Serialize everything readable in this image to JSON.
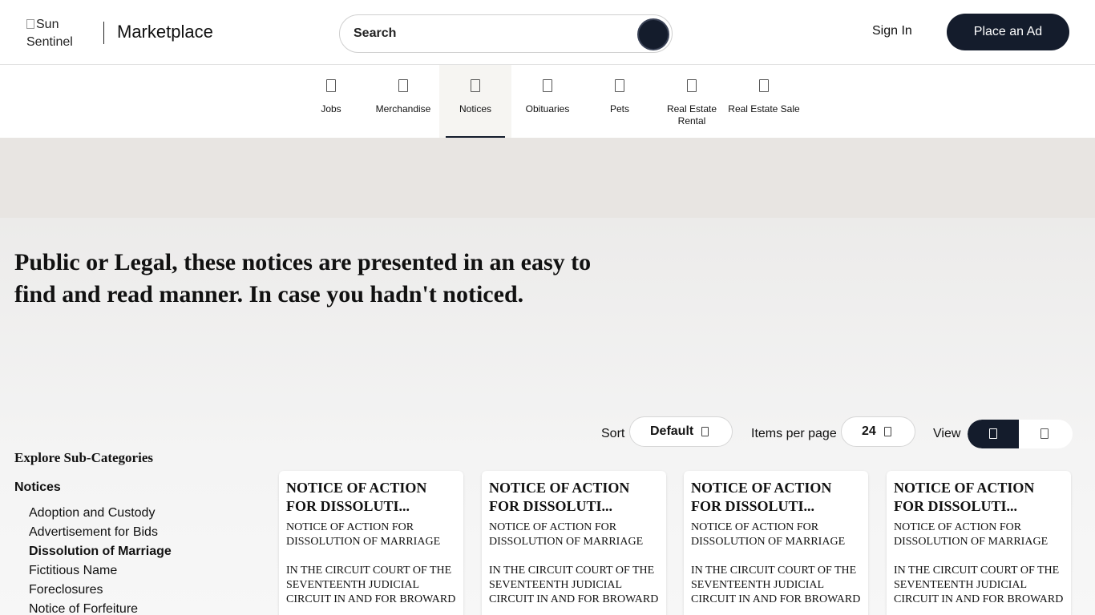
{
  "header": {
    "logo_alt": "Sun Sentinel",
    "brand": "Marketplace",
    "search_placeholder": "Search",
    "signin_label": "Sign In",
    "place_ad_label": "Place an Ad"
  },
  "nav": {
    "categories": [
      {
        "label": "Jobs",
        "icon": "glyph-missing"
      },
      {
        "label": "Merchandise",
        "icon": "glyph-missing"
      },
      {
        "label": "Notices",
        "icon": "glyph-missing",
        "active": true
      },
      {
        "label": "Obituaries",
        "icon": "glyph-missing"
      },
      {
        "label": "Pets",
        "icon": "glyph-missing"
      },
      {
        "label": "Real Estate Rental",
        "icon": "glyph-missing"
      },
      {
        "label": "Real Estate Sale",
        "icon": "glyph-missing"
      }
    ]
  },
  "hero": {
    "text": "Public or Legal, these notices are presented in an easy to find and read manner. In case you hadn't noticed."
  },
  "toolbar": {
    "sort_label": "Sort",
    "sort_value": "Default",
    "items_label": "Items per page",
    "items_value": "24",
    "view_label": "View"
  },
  "sidebar": {
    "title": "Explore Sub-Categories",
    "section": "Notices",
    "items": [
      "Adoption and Custody",
      "Advertisement for Bids",
      "Dissolution of Marriage",
      "Fictitious Name",
      "Foreclosures",
      "Notice of Forfeiture"
    ],
    "current_item": "Dissolution of Marriage"
  },
  "cards": [
    {
      "title": "NOTICE OF ACTION FOR DISSOLUTI...",
      "line1": "NOTICE OF ACTION FOR DISSOLUTION OF MARRIAGE",
      "line2": "IN THE CIRCUIT COURT OF THE SEVENTEENTH JUDICIAL CIRCUIT IN AND FOR BROWARD"
    },
    {
      "title": "NOTICE OF ACTION FOR DISSOLUTI...",
      "line1": "NOTICE OF ACTION FOR DISSOLUTION OF MARRIAGE",
      "line2": "IN THE CIRCUIT COURT OF THE SEVENTEENTH JUDICIAL CIRCUIT IN AND FOR BROWARD"
    },
    {
      "title": "NOTICE OF ACTION FOR DISSOLUTI...",
      "line1": "NOTICE OF ACTION FOR DISSOLUTION OF MARRIAGE",
      "line2": "IN THE CIRCUIT COURT OF THE SEVENTEENTH JUDICIAL CIRCUIT IN AND FOR BROWARD"
    },
    {
      "title": "NOTICE OF ACTION FOR DISSOLUTI...",
      "line1": "NOTICE OF ACTION FOR DISSOLUTION OF MARRIAGE",
      "line2": "IN THE CIRCUIT COURT OF THE SEVENTEENTH JUDICIAL CIRCUIT IN AND FOR BROWARD"
    }
  ],
  "colors": {
    "primary": "#141c2c",
    "banner": "#e8e5e2",
    "hero_bg": "#f0efee"
  }
}
